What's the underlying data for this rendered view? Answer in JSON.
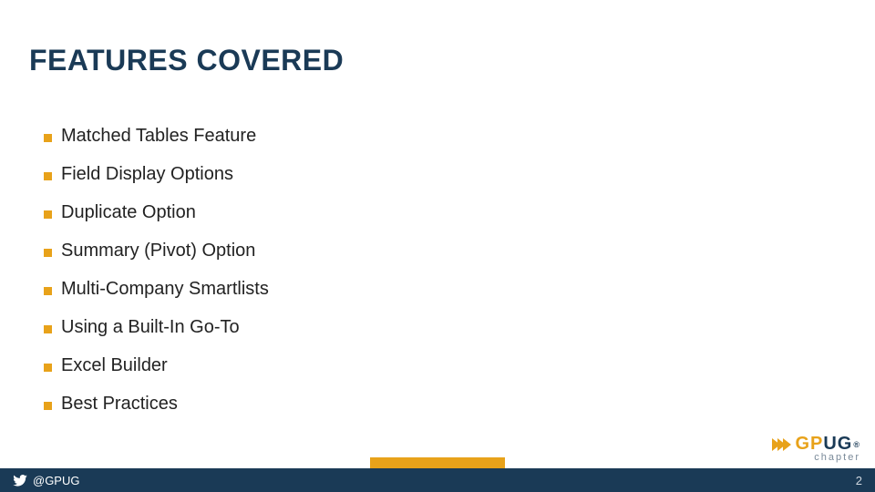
{
  "title": "FEATURES COVERED",
  "bullets": [
    "Matched Tables Feature",
    "Field Display Options",
    "Duplicate Option",
    "Summary (Pivot) Option",
    "Multi-Company Smartlists",
    "Using a Built-In Go-To",
    "Excel Builder",
    "Best Practices"
  ],
  "footer": {
    "handle": "@GPUG",
    "page": "2"
  },
  "logo": {
    "gp": "GP",
    "ug": "UG",
    "reg": "®",
    "sub": "chapter"
  }
}
